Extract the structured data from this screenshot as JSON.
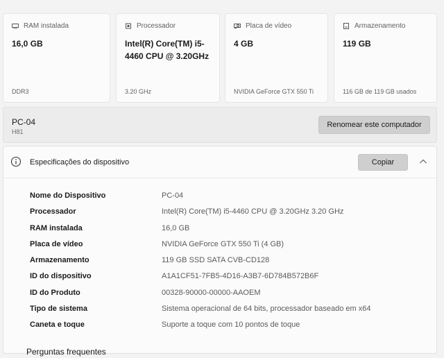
{
  "cards": [
    {
      "title": "RAM instalada",
      "value": "16,0 GB",
      "sub": "DDR3",
      "icon": "ram-icon"
    },
    {
      "title": "Processador",
      "value": "Intel(R) Core(TM) i5-4460  CPU @ 3.20GHz",
      "sub": "3.20 GHz",
      "icon": "processor-icon"
    },
    {
      "title": "Placa de vídeo",
      "value": "4 GB",
      "sub": "NVIDIA GeForce GTX 550 Ti",
      "icon": "gpu-icon"
    },
    {
      "title": "Armazenamento",
      "value": "119 GB",
      "sub": "116 GB de 119 GB usados",
      "icon": "storage-icon"
    }
  ],
  "pc": {
    "name": "PC-04",
    "model": "H81",
    "rename_label": "Renomear este computador"
  },
  "specs": {
    "title": "Especificações do dispositivo",
    "copy_label": "Copiar",
    "rows": [
      {
        "label": "Nome do Dispositivo",
        "value": "PC-04"
      },
      {
        "label": "Processador",
        "value": "Intel(R) Core(TM) i5-4460  CPU @ 3.20GHz   3.20 GHz"
      },
      {
        "label": "RAM instalada",
        "value": "16,0 GB"
      },
      {
        "label": "Placa de vídeo",
        "value": "NVIDIA GeForce GTX 550 Ti (4 GB)"
      },
      {
        "label": "Armazenamento",
        "value": "119 GB SSD SATA CVB-CD128"
      },
      {
        "label": "ID do dispositivo",
        "value": "A1A1CF51-7FB5-4D16-A3B7-6D784B572B6F"
      },
      {
        "label": "ID do Produto",
        "value": "00328-90000-00000-AAOEM"
      },
      {
        "label": "Tipo de sistema",
        "value": "Sistema operacional de 64 bits, processador baseado em x64"
      },
      {
        "label": "Caneta e toque",
        "value": "Suporte a toque com 10 pontos de toque"
      }
    ]
  },
  "faq": {
    "title": "Perguntas frequentes"
  }
}
